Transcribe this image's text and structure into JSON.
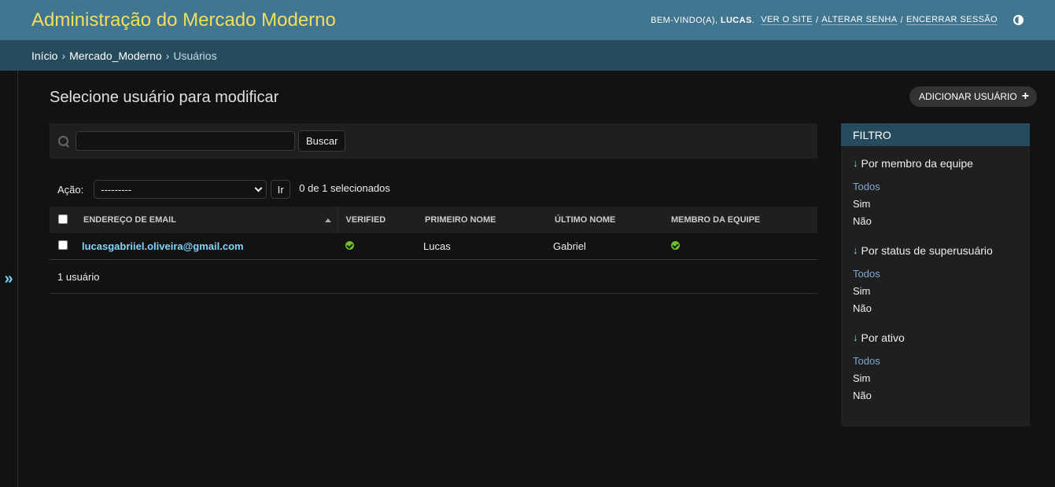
{
  "header": {
    "site_name": "Administração do Mercado Moderno",
    "welcome": "BEM-VINDO(A),",
    "username": "LUCAS",
    "links": [
      "VER O SITE",
      "ALTERAR SENHA",
      "ENCERRAR SESSÃO"
    ]
  },
  "breadcrumbs": {
    "items": [
      "Início",
      "Mercado_Moderno"
    ],
    "current": "Usuários"
  },
  "nav_toggle": "»",
  "content": {
    "title": "Selecione usuário para modificar",
    "add_button": "ADICIONAR USUÁRIO",
    "search": {
      "value": "",
      "button": "Buscar"
    },
    "actions": {
      "label": "Ação:",
      "selected": "---------",
      "go": "Ir",
      "counter": "0 de 1 selecionados"
    },
    "table": {
      "headers": [
        "ENDEREÇO DE EMAIL",
        "VERIFIED",
        "PRIMEIRO NOME",
        "ÚLTIMO NOME",
        "MEMBRO DA EQUIPE"
      ],
      "rows": [
        {
          "email": "lucasgabriiel.oliveira@gmail.com",
          "verified": true,
          "first_name": "Lucas",
          "last_name": "Gabriel",
          "staff": true
        }
      ]
    },
    "paginator": "1 usuário"
  },
  "filter": {
    "title": "FILTRO",
    "groups": [
      {
        "heading": "Por membro da equipe",
        "options": [
          "Todos",
          "Sim",
          "Não"
        ],
        "selected": "Todos"
      },
      {
        "heading": "Por status de superusuário",
        "options": [
          "Todos",
          "Sim",
          "Não"
        ],
        "selected": "Todos"
      },
      {
        "heading": "Por ativo",
        "options": [
          "Todos",
          "Sim",
          "Não"
        ],
        "selected": "Todos"
      }
    ]
  },
  "colors": {
    "header_bg": "#417690",
    "breadcrumbs_bg": "#264b5d",
    "site_name": "#f5dd5d",
    "link": "#81d4fa",
    "success": "#70bf2b"
  }
}
